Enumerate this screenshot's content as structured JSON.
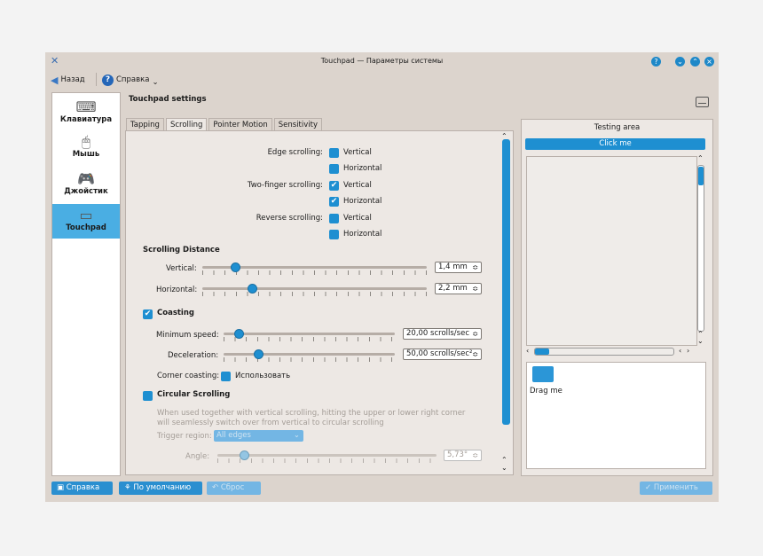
{
  "window": {
    "title": "Touchpad — Параметры системы"
  },
  "toolbar": {
    "back_label": "Назад",
    "help_menu_label": "Справка"
  },
  "sidebar": {
    "items": [
      {
        "label": "Клавиатура",
        "icon": "keyboard-icon"
      },
      {
        "label": "Мышь",
        "icon": "mouse-icon"
      },
      {
        "label": "Джойстик",
        "icon": "joystick-icon"
      },
      {
        "label": "Touchpad",
        "icon": "touchpad-icon",
        "selected": true
      }
    ]
  },
  "page": {
    "title": "Touchpad settings"
  },
  "tabs": [
    {
      "label": "Tapping"
    },
    {
      "label": "Scrolling",
      "active": true
    },
    {
      "label": "Pointer Motion"
    },
    {
      "label": "Sensitivity"
    }
  ],
  "scrolling": {
    "edge_label": "Edge scrolling:",
    "two_finger_label": "Two-finger scrolling:",
    "reverse_label": "Reverse scrolling:",
    "vertical": "Vertical",
    "horizontal": "Horizontal",
    "edge_vertical": false,
    "edge_horizontal": false,
    "two_finger_vertical": true,
    "two_finger_horizontal": true,
    "reverse_vertical": false,
    "reverse_horizontal": false,
    "distance_header": "Scrolling Distance",
    "distance_vertical_label": "Vertical:",
    "distance_vertical_value": "1,4 mm",
    "distance_horizontal_label": "Horizontal:",
    "distance_horizontal_value": "2,2 mm",
    "coasting_label": "Coasting",
    "coasting_checked": true,
    "min_speed_label": "Minimum speed:",
    "min_speed_value": "20,00 scrolls/sec",
    "deceleration_label": "Deceleration:",
    "deceleration_value": "50,00 scrolls/sec²",
    "corner_label": "Corner coasting:",
    "corner_checkbox_label": "Использовать",
    "circular_label": "Circular Scrolling",
    "circular_checked": false,
    "circular_description": "When used together with vertical scrolling, hitting the upper or lower right corner will seamlessly switch over from vertical to circular scrolling",
    "trigger_label": "Trigger region:",
    "trigger_value": "All edges",
    "angle_label": "Angle:",
    "angle_value": "5,73°"
  },
  "testing": {
    "title": "Testing area",
    "click_label": "Click me",
    "drag_label": "Drag me"
  },
  "buttons": {
    "help": "Справка",
    "defaults": "По умолчанию",
    "reset": "Сброс",
    "apply": "Применить"
  }
}
